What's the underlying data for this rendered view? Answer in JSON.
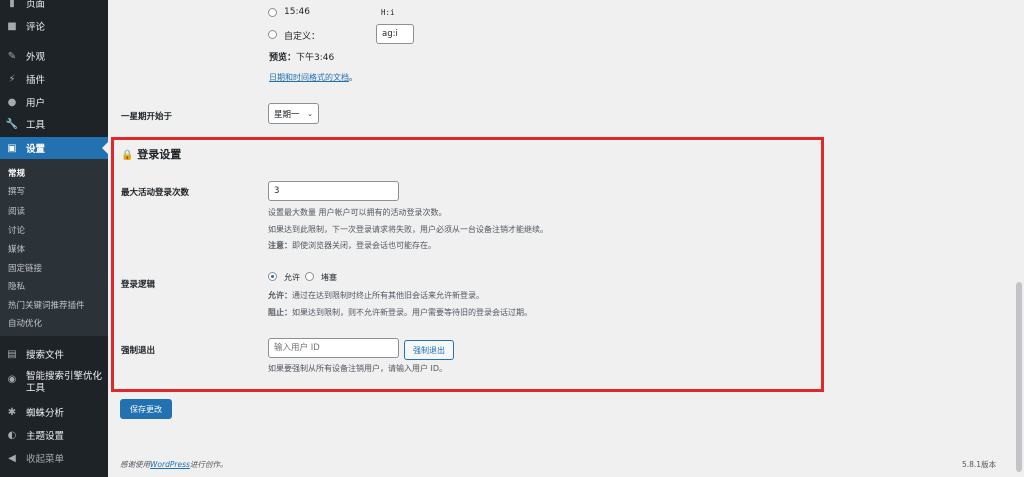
{
  "sidebar": {
    "top_items": [
      {
        "label": "页面",
        "icon": "page-icon"
      },
      {
        "label": "评论",
        "icon": "comment-icon"
      },
      {
        "label": "外观",
        "icon": "brush-icon"
      },
      {
        "label": "插件",
        "icon": "plugin-icon"
      },
      {
        "label": "用户",
        "icon": "user-icon"
      },
      {
        "label": "工具",
        "icon": "wrench-icon"
      },
      {
        "label": "设置",
        "icon": "settings-icon"
      }
    ],
    "submenu": [
      "常规",
      "撰写",
      "阅读",
      "讨论",
      "媒体",
      "固定链接",
      "隐私",
      "热门关键词推荐插件",
      "自动优化"
    ],
    "bottom_items": [
      {
        "label": "搜索文件",
        "icon": "file-search-icon"
      },
      {
        "label": "智能搜索引擎优化",
        "label2": "工具",
        "icon": "seo-icon"
      },
      {
        "label": "蜘蛛分析",
        "icon": "spider-icon"
      },
      {
        "label": "主题设置",
        "icon": "theme-icon"
      },
      {
        "label": "收起菜单",
        "icon": "collapse-icon"
      }
    ]
  },
  "time_format": {
    "option_1": "15:46",
    "option_1_code": "H:i",
    "custom_label": "自定义：",
    "custom_value": "ag:i",
    "preview_label": "预览：",
    "preview_value": "下午3:46",
    "doc_link": "日期和时间格式的文档",
    "doc_link_suffix": "。"
  },
  "week_start": {
    "label": "一星期开始于",
    "value": "星期一"
  },
  "login_settings": {
    "heading": "登录设置",
    "max_sessions_label": "最大活动登录次数",
    "max_sessions_value": "3",
    "max_desc_1": "设置最大数量 用户帐户可以拥有的活动登录次数。",
    "max_desc_2": "如果达到此限制，下一次登录请求将失败，用户必须从一台设备注销才能继续。",
    "max_desc_3_bold": "注意：",
    "max_desc_3": "即使浏览器关闭，登录会话也可能存在。",
    "logic_label": "登录逻辑",
    "logic_allow": "允许",
    "logic_block": "堵塞",
    "logic_allow_desc_bold": "允许：",
    "logic_allow_desc": "通过在达到限制时终止所有其他旧会话来允许新登录。",
    "logic_block_desc_bold": "阻止：",
    "logic_block_desc": "如果达到限制，则不允许新登录。用户需要等待旧的登录会话过期。",
    "force_logout_label": "强制退出",
    "force_logout_placeholder": "输入用户 ID",
    "force_logout_button": "强制退出",
    "force_logout_desc": "如果要强制从所有设备注销用户，请输入用户 ID。"
  },
  "save_button": "保存更改",
  "footer": {
    "thanks_prefix": "感谢使用",
    "thanks_link": "WordPress",
    "thanks_suffix": "进行创作。",
    "version": "5.8.1版本"
  },
  "colors": {
    "accent": "#2271b1",
    "sidebar_bg": "#1d2327",
    "highlight_box": "#e0282b"
  }
}
